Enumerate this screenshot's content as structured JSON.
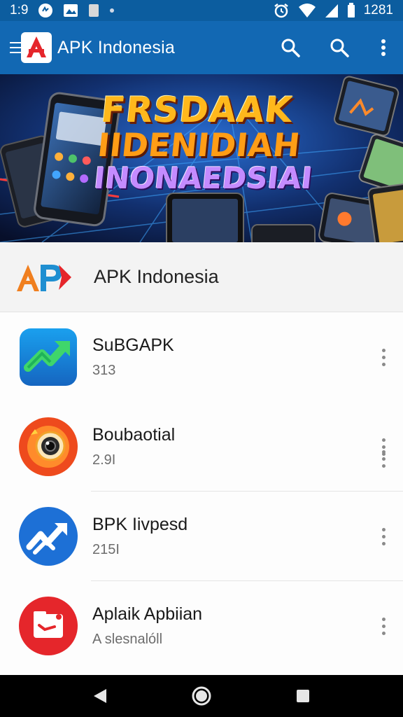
{
  "status_bar": {
    "time": "1:9",
    "clock": "1281",
    "icons": [
      "notification-icon",
      "photo-icon",
      "sim-icon",
      "dot-icon",
      "alarm-icon",
      "wifi-icon",
      "signal-icon",
      "battery-icon"
    ]
  },
  "app_bar": {
    "title": "APK Indonesia",
    "icons": [
      "menu-icon",
      "app-logo",
      "search-icon",
      "search-icon",
      "more-vert-icon"
    ]
  },
  "banner": {
    "line1": "FRSDAAK",
    "line2": "IIDENIDIAH",
    "line3": "INONAEDSIAI"
  },
  "list_header": {
    "logo_text": "AP",
    "title": "APK Indonesia"
  },
  "apps": [
    {
      "name": "SuBGAPK",
      "sub": "313",
      "icon": "trend-up-icon",
      "color": "#1e8ce0"
    },
    {
      "name": "Boubaotial",
      "sub": "2.9I",
      "icon": "camera-icon",
      "color": "#ef4a1c"
    },
    {
      "name": "BPK Iivpesd",
      "sub": "215I",
      "icon": "chart-arrow-icon",
      "color": "#1d70d6"
    },
    {
      "name": "Aplaik Apbiian",
      "sub": "A slesnalóll",
      "icon": "folder-check-icon",
      "color": "#e5262b"
    }
  ],
  "nav_bar": {
    "icons": [
      "back-icon",
      "home-icon",
      "recents-icon"
    ]
  },
  "colors": {
    "status_bar": "#0c5d9f",
    "app_bar": "#1268b3",
    "accent_red": "#e5262b"
  }
}
